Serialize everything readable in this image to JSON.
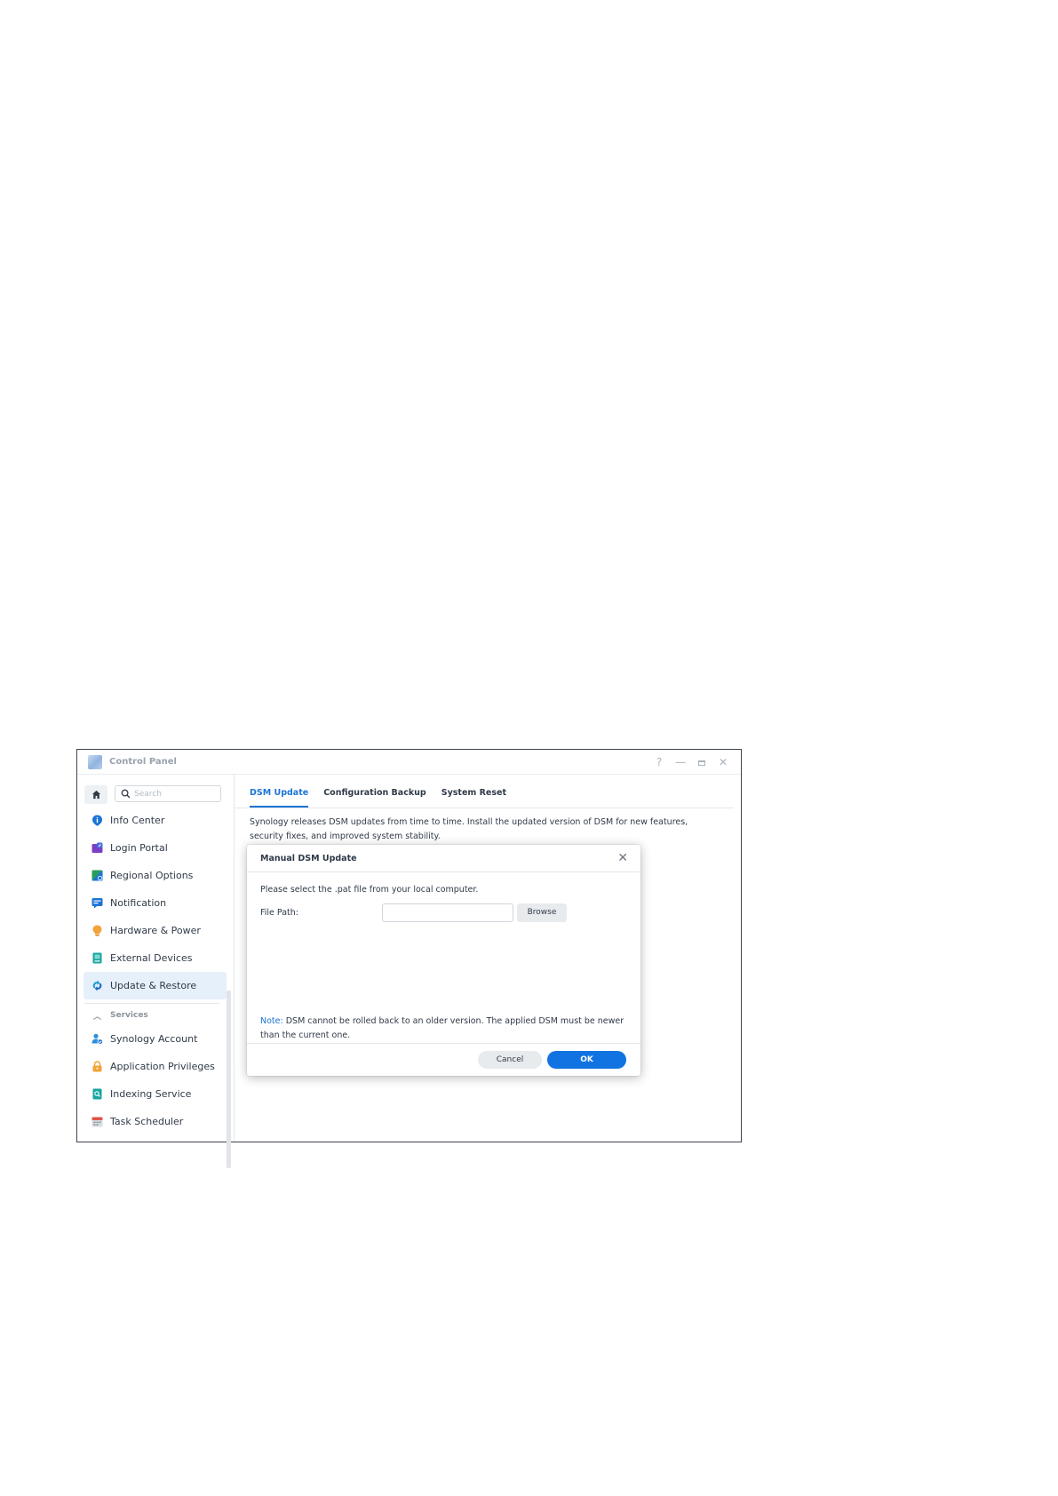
{
  "window": {
    "title": "Control Panel",
    "controls": {
      "help": "?",
      "minimize": "—",
      "close": "✕"
    }
  },
  "sidebar": {
    "search_placeholder": "Search",
    "items": [
      {
        "label": "Info Center",
        "icon": "info-icon",
        "color": "#1c74d4"
      },
      {
        "label": "Login Portal",
        "icon": "login-portal-icon",
        "color": "#7b3fc4"
      },
      {
        "label": "Regional Options",
        "icon": "regional-options-icon",
        "color": "#2a9d5c"
      },
      {
        "label": "Notification",
        "icon": "notification-icon",
        "color": "#1c74d4"
      },
      {
        "label": "Hardware & Power",
        "icon": "hardware-power-icon",
        "color": "#f2a33a"
      },
      {
        "label": "External Devices",
        "icon": "external-devices-icon",
        "color": "#17a5a0"
      },
      {
        "label": "Update & Restore",
        "icon": "update-restore-icon",
        "color": "#1c9ad6",
        "active": true
      }
    ],
    "group_header": "Services",
    "service_items": [
      {
        "label": "Synology Account",
        "icon": "synology-account-icon",
        "color": "#2e8fd8"
      },
      {
        "label": "Application Privileges",
        "icon": "lock-icon",
        "color": "#f2a33a"
      },
      {
        "label": "Indexing Service",
        "icon": "indexing-service-icon",
        "color": "#17a5a0"
      },
      {
        "label": "Task Scheduler",
        "icon": "calendar-icon",
        "color": "#e0524a"
      }
    ]
  },
  "tabs": [
    {
      "label": "DSM Update",
      "active": true
    },
    {
      "label": "Configuration Backup"
    },
    {
      "label": "System Reset"
    }
  ],
  "main": {
    "description": "Synology releases DSM updates from time to time. Install the updated version of DSM for new features, security fixes, and improved system stability."
  },
  "dialog": {
    "title": "Manual DSM Update",
    "instruction": "Please select the .pat file from your local computer.",
    "file_path_label": "File Path:",
    "file_path_value": "",
    "browse_label": "Browse",
    "note_label": "Note:",
    "note_text": " DSM cannot be rolled back to an older version. The applied DSM must be newer than the current one.",
    "cancel_label": "Cancel",
    "ok_label": "OK"
  },
  "colors": {
    "accent": "#1c74d4",
    "ok_button": "#1173e2"
  }
}
